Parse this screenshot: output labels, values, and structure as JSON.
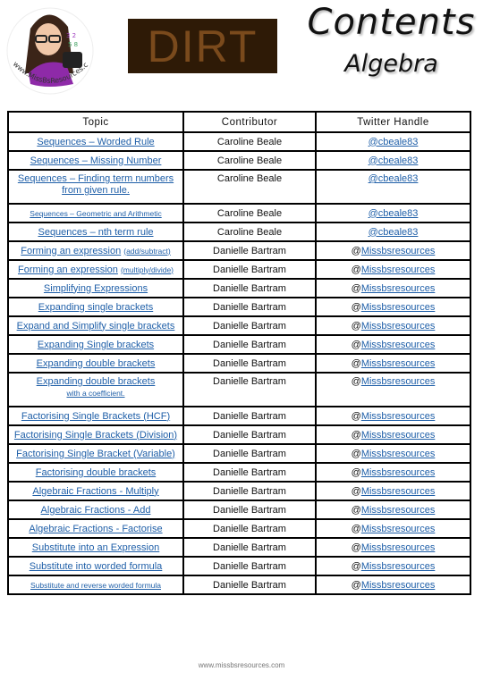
{
  "header": {
    "logo_text": "www.MissBsResources.com",
    "dirt_label": "DIRT",
    "title": "Contents",
    "subtitle": "Algebra"
  },
  "table": {
    "columns": [
      "Topic",
      "Contributor",
      "Twitter Handle"
    ],
    "rows": [
      {
        "topic": "Sequences – Worded Rule",
        "topic_note": "",
        "contributor": "Caroline Beale",
        "handle_prefix": "",
        "handle": "@cbeale83"
      },
      {
        "topic": "Sequences – Missing Number",
        "topic_note": "",
        "contributor": "Caroline Beale",
        "handle_prefix": "",
        "handle": "@cbeale83"
      },
      {
        "topic": "Sequences – Finding term numbers from given rule.",
        "topic_note": "",
        "contributor": "Caroline Beale",
        "handle_prefix": "",
        "handle": "@cbeale83"
      },
      {
        "topic": "Sequences – Geometric and Arithmetic",
        "topic_note": "",
        "contributor": "Caroline Beale",
        "handle_prefix": "",
        "handle": "@cbeale83"
      },
      {
        "topic": "Sequences – nth term rule",
        "topic_note": "",
        "contributor": "Caroline Beale",
        "handle_prefix": "",
        "handle": "@cbeale83"
      },
      {
        "topic": "Forming an expression",
        "topic_note": "(add/subtract)",
        "contributor": "Danielle Bartram",
        "handle_prefix": "@",
        "handle": "Missbsresources"
      },
      {
        "topic": "Forming an expression",
        "topic_note": "(multiply/divide)",
        "contributor": "Danielle Bartram",
        "handle_prefix": "@",
        "handle": "Missbsresources"
      },
      {
        "topic": "Simplifying Expressions",
        "topic_note": "",
        "contributor": "Danielle Bartram",
        "handle_prefix": "@",
        "handle": "Missbsresources"
      },
      {
        "topic": "Expanding single brackets",
        "topic_note": "",
        "contributor": "Danielle Bartram",
        "handle_prefix": "@",
        "handle": "Missbsresources"
      },
      {
        "topic": "Expand and Simplify single brackets",
        "topic_note": "",
        "contributor": "Danielle Bartram",
        "handle_prefix": "@",
        "handle": "Missbsresources"
      },
      {
        "topic": "Expanding Single brackets",
        "topic_note": "",
        "contributor": "Danielle Bartram",
        "handle_prefix": "@",
        "handle": "Missbsresources"
      },
      {
        "topic": "Expanding double brackets",
        "topic_note": "",
        "contributor": "Danielle Bartram",
        "handle_prefix": "@",
        "handle": "Missbsresources"
      },
      {
        "topic": "Expanding double brackets",
        "topic_note": "with a coefficient.",
        "contributor": "Danielle Bartram",
        "handle_prefix": "@",
        "handle": "Missbsresources"
      },
      {
        "topic": "Factorising Single Brackets (HCF)",
        "topic_note": "",
        "contributor": "Danielle Bartram",
        "handle_prefix": "@",
        "handle": "Missbsresources"
      },
      {
        "topic": "Factorising Single Brackets (Division)",
        "topic_note": "",
        "contributor": "Danielle Bartram",
        "handle_prefix": "@",
        "handle": "Missbsresources"
      },
      {
        "topic": "Factorising Single Bracket (Variable)",
        "topic_note": "",
        "contributor": "Danielle Bartram",
        "handle_prefix": "@",
        "handle": "Missbsresources"
      },
      {
        "topic": "Factorising double brackets",
        "topic_note": "",
        "contributor": "Danielle Bartram",
        "handle_prefix": "@",
        "handle": "Missbsresources"
      },
      {
        "topic": "Algebraic Fractions - Multiply",
        "topic_note": "",
        "contributor": "Danielle Bartram",
        "handle_prefix": "@",
        "handle": "Missbsresources"
      },
      {
        "topic": "Algebraic Fractions - Add",
        "topic_note": "",
        "contributor": "Danielle Bartram",
        "handle_prefix": "@",
        "handle": "Missbsresources"
      },
      {
        "topic": "Algebraic Fractions - Factorise",
        "topic_note": "",
        "contributor": "Danielle Bartram",
        "handle_prefix": "@",
        "handle": "Missbsresources"
      },
      {
        "topic": "Substitute into an Expression",
        "topic_note": "",
        "contributor": "Danielle Bartram",
        "handle_prefix": "@",
        "handle": "Missbsresources"
      },
      {
        "topic": "Substitute into worded formula",
        "topic_note": "",
        "contributor": "Danielle Bartram",
        "handle_prefix": "@",
        "handle": "Missbsresources"
      },
      {
        "topic": "Substitute and reverse worded formula",
        "topic_note": "",
        "contributor": "Danielle Bartram",
        "handle_prefix": "@",
        "handle": "Missbsresources"
      }
    ]
  },
  "footer": {
    "website": "www.missbsresources.com"
  },
  "colors": {
    "link": "#1f5fa8",
    "dirt_bg": "#2e1a06",
    "dirt_text": "#7a4a1c"
  }
}
